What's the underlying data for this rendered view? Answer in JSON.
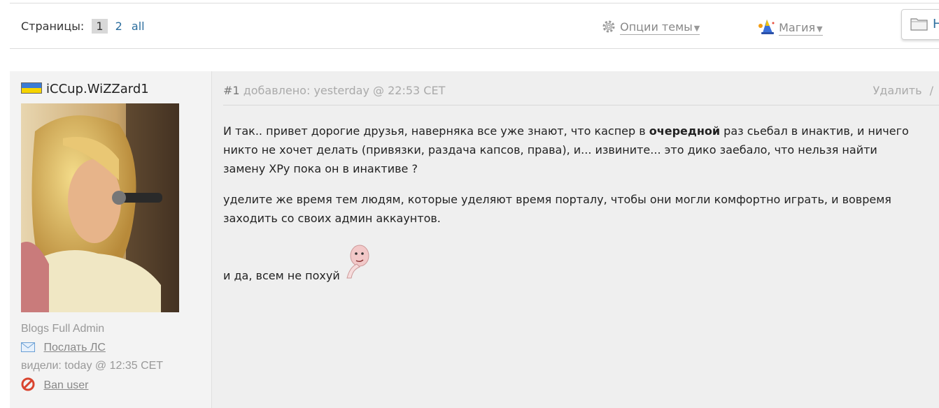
{
  "pagination": {
    "label": "Страницы:",
    "current": "1",
    "pages": [
      "2",
      "all"
    ]
  },
  "toolbar": {
    "topic_options": "Опции темы",
    "magic": "Магия",
    "new_button": "Н"
  },
  "post": {
    "author": {
      "username": "iCCup.WiZZard1",
      "role": "Blogs Full Admin",
      "send_pm": "Послать ЛС",
      "seen": "видели: today @ 12:35 CET",
      "ban": "Ban user"
    },
    "number": "#1",
    "added": "добавлено: yesterday @ 22:53 CET",
    "delete": "Удалить",
    "delete_sep": "/",
    "text": {
      "p1_a": "И так.. привет дорогие друзья, наверняка все уже знают, что каспер в ",
      "p1_bold": "очередной",
      "p1_b": " раз сьебал в инактив, и ничего никто не хочет делать (привязки, раздача капсов, права), и... извините... это дико заебало, что нельзя найти замену XPу пока он в инактиве ?",
      "p2": "уделите же время тем людям, которые уделяют время порталу, чтобы они могли комфортно играть, и вовремя заходить со своих админ аккаунтов.",
      "p3": "и да, всем не похуй"
    }
  },
  "icons": {
    "topic_options": "gear-icon",
    "magic": "wizard-hat-icon",
    "new": "folder-icon",
    "pm": "envelope-icon",
    "ban": "ban-icon",
    "flag": "flag-icon",
    "smiley": "thinking-smiley-icon"
  },
  "colors": {
    "link": "#2c6e9e",
    "post_bg": "#efefef",
    "ban": "#d9442f"
  }
}
